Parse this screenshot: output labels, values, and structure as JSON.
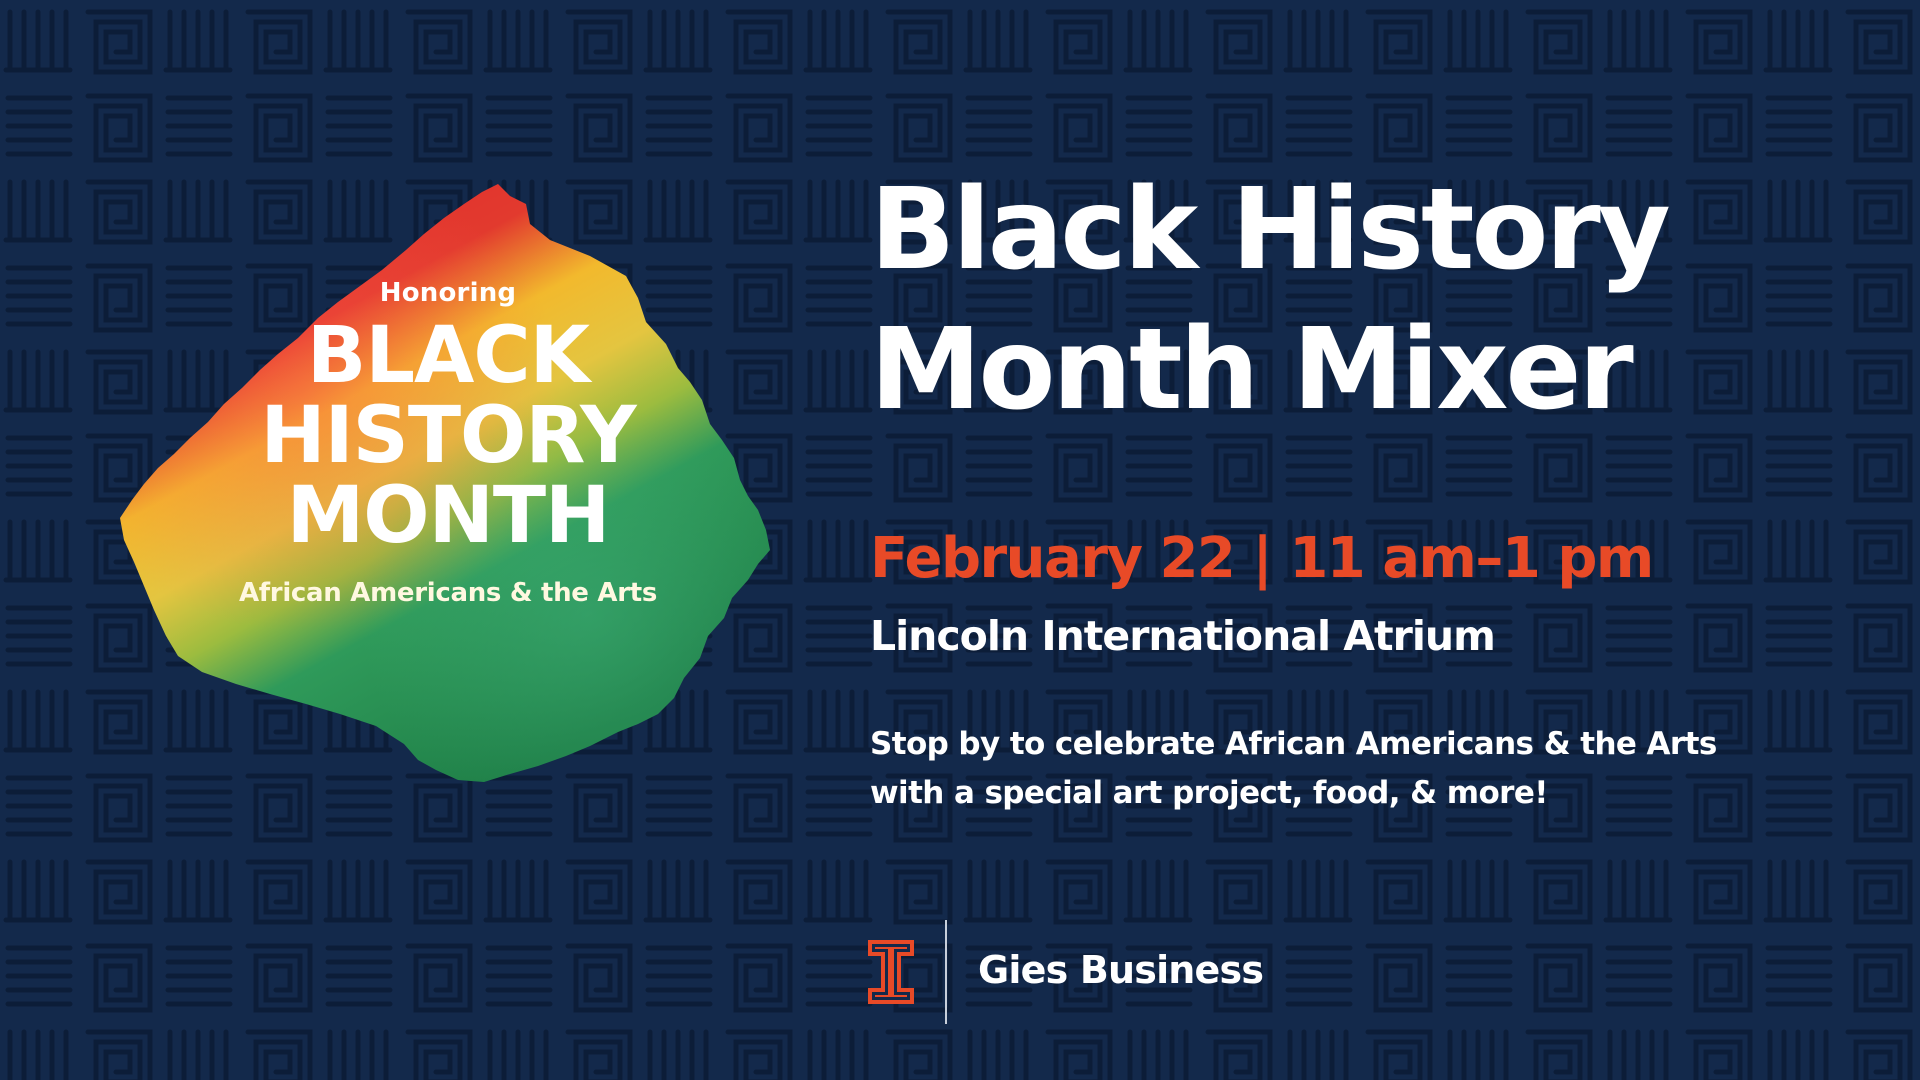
{
  "colors": {
    "background": "#13294b",
    "pattern": "#0c1d38",
    "accent_orange": "#e84a27",
    "text": "#ffffff",
    "badge_red": "#e1262b",
    "badge_yellow": "#f2c12e",
    "badge_green": "#2b9a5e"
  },
  "badge": {
    "honoring": "Honoring",
    "title_lines": [
      "BLACK",
      "HISTORY",
      "MONTH"
    ],
    "subtitle": "African Americans & the Arts"
  },
  "event": {
    "title_lines": [
      "Black History",
      "Month Mixer"
    ],
    "datetime": "February 22 | 11 am–1 pm",
    "location": "Lincoln International Atrium",
    "description_lines": [
      "Stop by to celebrate African Americans & the Arts",
      "with a special art project, food, & more!"
    ]
  },
  "footer": {
    "logo_icon": "block-i-icon",
    "organization": "Gies Business"
  }
}
